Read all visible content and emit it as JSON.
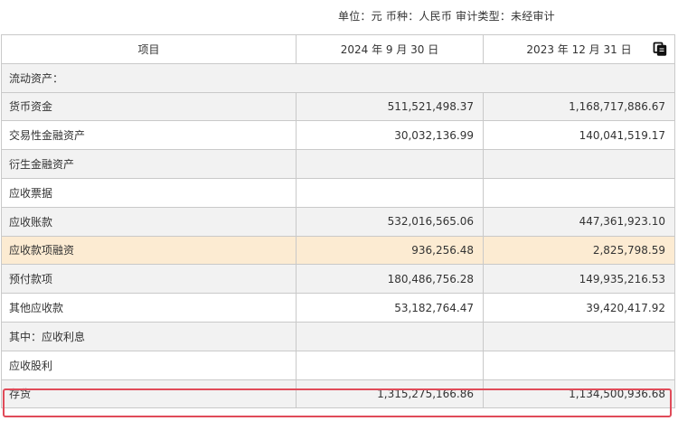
{
  "meta": {
    "text": "单位：元  币种：人民币  审计类型：未经审计"
  },
  "header": {
    "col1": "项目",
    "col2": "2024 年 9 月 30 日",
    "col3": "2023 年 12 月 31 日",
    "copy_icon": "copy-icon"
  },
  "rows": [
    {
      "label": "流动资产：",
      "v1": "",
      "v2": "",
      "type": "section"
    },
    {
      "label": "货币资金",
      "v1": "511,521,498.37",
      "v2": "1,168,717,886.67",
      "type": "grey"
    },
    {
      "label": "交易性金融资产",
      "v1": "30,032,136.99",
      "v2": "140,041,519.17",
      "type": "white"
    },
    {
      "label": "衍生金融资产",
      "v1": "",
      "v2": "",
      "type": "grey"
    },
    {
      "label": "应收票据",
      "v1": "",
      "v2": "",
      "type": "white"
    },
    {
      "label": "应收账款",
      "v1": "532,016,565.06",
      "v2": "447,361,923.10",
      "type": "grey"
    },
    {
      "label": "应收款项融资",
      "v1": "936,256.48",
      "v2": "2,825,798.59",
      "type": "hl"
    },
    {
      "label": "预付款项",
      "v1": "180,486,756.28",
      "v2": "149,935,216.53",
      "type": "grey"
    },
    {
      "label": "其他应收款",
      "v1": "53,182,764.47",
      "v2": "39,420,417.92",
      "type": "white"
    },
    {
      "label": "其中：应收利息",
      "v1": "",
      "v2": "",
      "type": "grey"
    },
    {
      "label": "应收股利",
      "v1": "",
      "v2": "",
      "type": "white"
    },
    {
      "label": "存货",
      "v1": "1,315,275,166.86",
      "v2": "1,134,500,936.68",
      "type": "grey"
    }
  ],
  "colors": {
    "highlight_row": "#fcebd2",
    "selection_border": "#e04b59"
  }
}
